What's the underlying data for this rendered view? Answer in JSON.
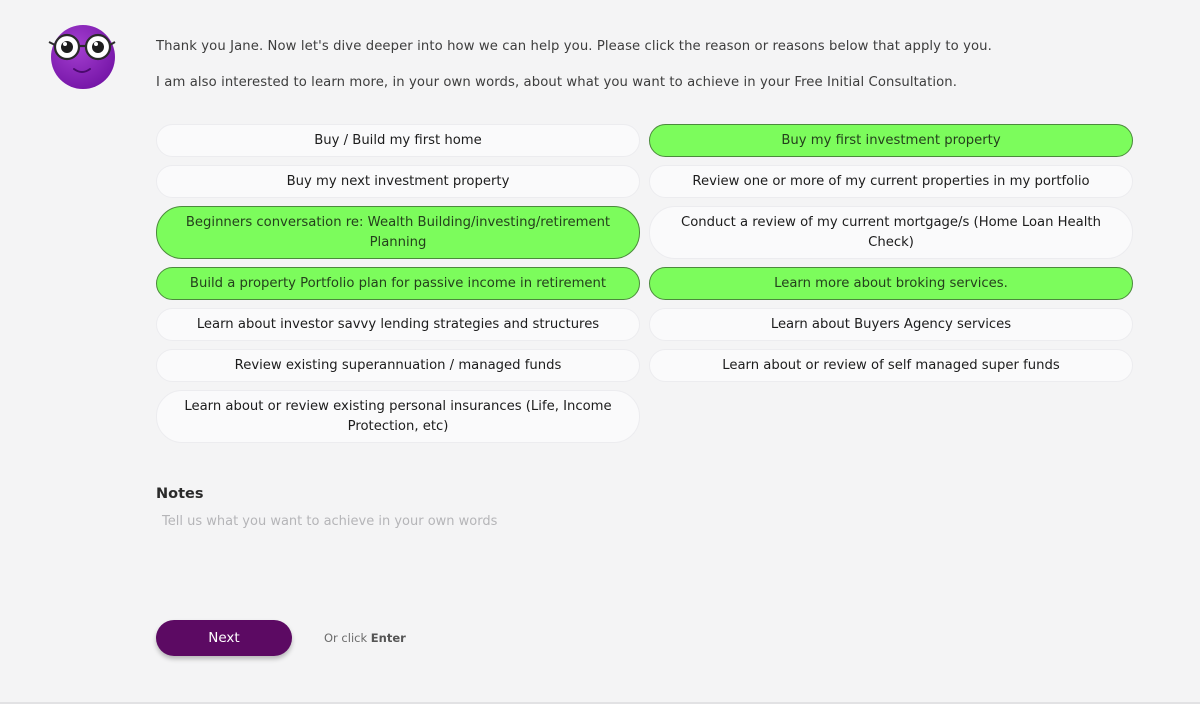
{
  "header": {
    "line1": "Thank you Jane. Now let's dive deeper into how we can help you. Please click the reason or reasons below that apply to you.",
    "line2": "I am also interested to learn more, in your own words, about what you want to achieve in your Free Initial Consultation."
  },
  "avatar": {
    "icon": "purple-glasses-mascot-icon",
    "color": "#8a1fb4"
  },
  "options": [
    {
      "label": "Buy / Build my first home",
      "selected": false
    },
    {
      "label": "Buy my first investment property",
      "selected": true
    },
    {
      "label": "Buy my next investment property",
      "selected": false
    },
    {
      "label": "Review one or more of my current properties in my portfolio",
      "selected": false
    },
    {
      "label": "Beginners conversation re: Wealth Building/investing/retirement Planning",
      "selected": true
    },
    {
      "label": "Conduct a review of my current mortgage/s (Home Loan Health Check)",
      "selected": false
    },
    {
      "label": "Build a property Portfolio plan for passive income in retirement",
      "selected": true
    },
    {
      "label": "Learn more about broking services.",
      "selected": true
    },
    {
      "label": "Learn about investor savvy lending strategies and structures",
      "selected": false
    },
    {
      "label": "Learn about Buyers Agency services",
      "selected": false
    },
    {
      "label": "Review existing superannuation / managed funds",
      "selected": false
    },
    {
      "label": "Learn about or review of self managed super funds",
      "selected": false
    },
    {
      "label": "Learn about or review existing personal insurances (Life, Income Protection, etc)",
      "selected": false
    }
  ],
  "notes": {
    "label": "Notes",
    "placeholder": "Tell us what you want to achieve in your own words",
    "value": ""
  },
  "actions": {
    "next_label": "Next",
    "hint_prefix": "Or click",
    "hint_key": "Enter"
  },
  "colors": {
    "selected": "#7cfc5c",
    "button": "#5c0a63",
    "background": "#f4f4f5"
  }
}
